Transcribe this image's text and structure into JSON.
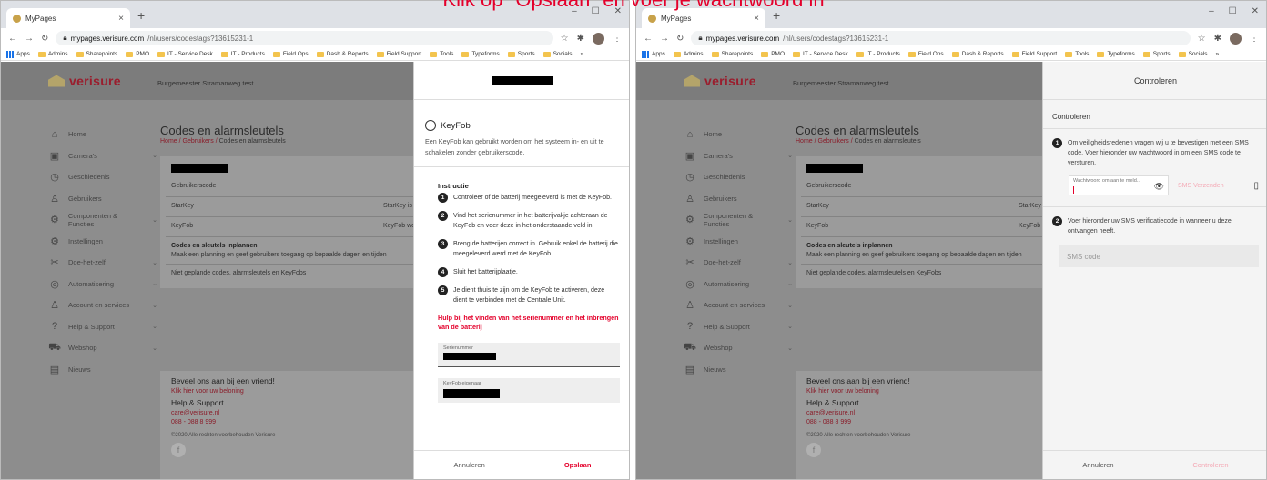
{
  "caption": "Klik op \"Opslaan\" en voer je wachtwoord in",
  "browser": {
    "tab_title": "MyPages",
    "url_host": "mypages.verisure.com",
    "url_path": "/nl/users/codestags?13615231-1",
    "bookmarks": [
      "Apps",
      "Admins",
      "Sharepoints",
      "PMO",
      "IT - Service Desk",
      "IT - Products",
      "Field Ops",
      "Dash & Reports",
      "Field Support",
      "Tools",
      "Typeforms",
      "Sports",
      "Socials"
    ],
    "more": "»"
  },
  "site": {
    "logo": "verisure",
    "address": "Burgemeester Stramanweg test",
    "nav": [
      {
        "label": "Home",
        "icon": "⌂",
        "chev": ""
      },
      {
        "label": "Camera's",
        "icon": "▣",
        "chev": "⌄"
      },
      {
        "label": "Geschiedenis",
        "icon": "◷",
        "chev": ""
      },
      {
        "label": "Gebruikers",
        "icon": "♙",
        "chev": ""
      },
      {
        "label": "Componenten & Functies",
        "icon": "⚙",
        "chev": "⌄"
      },
      {
        "label": "Instellingen",
        "icon": "⚙",
        "chev": ""
      },
      {
        "label": "Doe-het-zelf",
        "icon": "✂",
        "chev": "⌄"
      },
      {
        "label": "Automatisering",
        "icon": "◎",
        "chev": "⌄"
      },
      {
        "label": "Account en services",
        "icon": "♙",
        "chev": "⌄"
      },
      {
        "label": "Help & Support",
        "icon": "?",
        "chev": "⌄"
      },
      {
        "label": "Webshop",
        "icon": "⛟",
        "chev": "⌄"
      },
      {
        "label": "Nieuws",
        "icon": "▤",
        "chev": ""
      }
    ],
    "page_title": "Codes en alarmsleutels",
    "crumb_home": "Home",
    "crumb_users": "Gebruikers",
    "crumb_current": "Codes en alarmsleutels",
    "user_code": "Gebruikerscode",
    "starkey": "StarKey",
    "starkey_val": "StarKey is",
    "keyfob": "KeyFob",
    "keyfob_val": "KeyFob wo",
    "plan_title": "Codes en sleutels inplannen",
    "plan_desc": "Maak een planning en geef gebruikers toegang op bepaalde dagen en tijden",
    "unplanned": "Niet geplande codes, alarmsleutels en KeyFobs",
    "footer": {
      "refer_title": "Beveel ons aan bij een vriend!",
      "refer_link": "Klik hier voor uw beloning",
      "help_title": "Help & Support",
      "email": "care@verisure.nl",
      "phone": "088 - 088 8 999",
      "copyright": "©2020 Alle rechten voorbehouden Verisure",
      "fb": "f"
    }
  },
  "left_drawer": {
    "kf_title": "KeyFob",
    "kf_desc": "Een KeyFob kan gebruikt worden om het systeem in- en uit te schakelen zonder gebruikerscode.",
    "instr_label": "Instructie",
    "steps": [
      "Controleer of de batterij meegeleverd is met de KeyFob.",
      "Vind het serienummer in het batterijvakje achteraan de KeyFob en voer deze in het onderstaande veld in.",
      "Breng de batterijen correct in. Gebruik enkel de batterij die meegeleverd werd met de KeyFob.",
      "Sluit het batterijplaatje.",
      "Je dient thuis te zijn om de KeyFob te activeren, deze dient te verbinden met de Centrale Unit."
    ],
    "help_link": "Hulp bij het vinden van het serienummer en het inbrengen van de batterij",
    "serial_label": "Serienummer",
    "owner_label": "KeyFob eigenaar",
    "cancel": "Annuleren",
    "save": "Opslaan"
  },
  "right_drawer": {
    "header": "Controleren",
    "section_title": "Controleren",
    "step1": "Om veiligheidsredenen vragen wij u te bevestigen met een SMS code. Voer hieronder uw wachtwoord in om een SMS code te versturen.",
    "pw_label": "Wachtwoord om aan te meld...",
    "sms_send": "SMS Verzenden",
    "step2": "Voer hieronder uw SMS verificatiecode in wanneer u deze ontvangen heeft.",
    "sms_placeholder": "SMS code",
    "cancel": "Annuleren",
    "check": "Controleren"
  }
}
